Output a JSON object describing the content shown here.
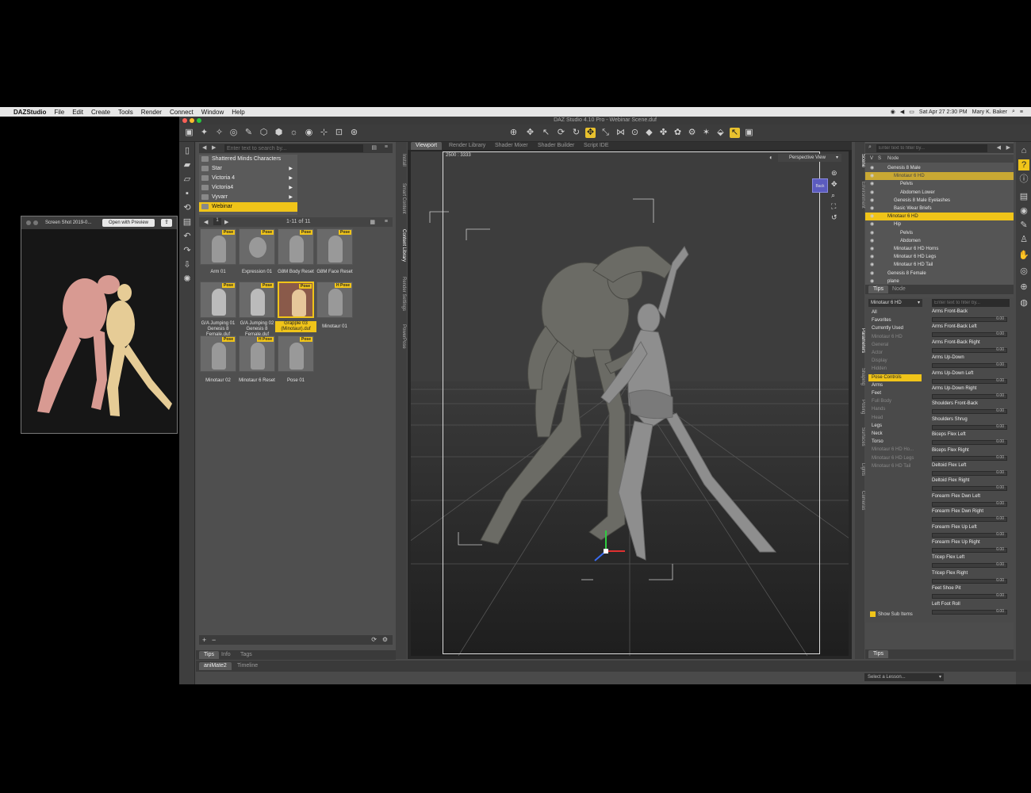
{
  "menubar": {
    "app": "DAZStudio",
    "items": [
      "File",
      "Edit",
      "Create",
      "Tools",
      "Render",
      "Connect",
      "Window",
      "Help"
    ],
    "datetime": "Sat Apr 27  2:30 PM",
    "user": "Mary K. Baker"
  },
  "window": {
    "title": "DAZ Studio 4.10 Pro - Webinar Scene.duf"
  },
  "content_library": {
    "search_placeholder": "Enter text to search by...",
    "folders": [
      {
        "label": "Shattered Minds Characters",
        "has_arrow": false
      },
      {
        "label": "Star",
        "has_arrow": true
      },
      {
        "label": "Victoria 4",
        "has_arrow": true
      },
      {
        "label": "Victoria4",
        "has_arrow": true
      },
      {
        "label": "Vyvarr",
        "has_arrow": true
      },
      {
        "label": "Webinar",
        "has_arrow": false,
        "selected": true
      }
    ],
    "page_info": "1-11 of 11",
    "items": [
      {
        "label": "Arm 01",
        "tag": "Pose"
      },
      {
        "label": "Expression 01",
        "tag": "Pose"
      },
      {
        "label": "G8M Body Reset",
        "tag": "Pose"
      },
      {
        "label": "G8M Face Reset",
        "tag": "Pose"
      },
      {
        "label": "G/A Jumping 01 Genesis 8 Female.duf",
        "tag": "Pose"
      },
      {
        "label": "G/A Jumping 02 Genesis 8 Female.duf",
        "tag": "Pose"
      },
      {
        "label": "Grapple 03 (Minotaur).duf",
        "tag": "Pose",
        "selected": true
      },
      {
        "label": "Minotaur 01",
        "tag": "H Pose"
      },
      {
        "label": "Minotaur 02",
        "tag": "Pose"
      },
      {
        "label": "Minotaur 6 Reset",
        "tag": "H Pose"
      },
      {
        "label": "Pose 01",
        "tag": "Pose"
      }
    ],
    "tabs": [
      "Tips",
      "Info",
      "Tags"
    ]
  },
  "left_vtabs": [
    "Install",
    "Smart Content",
    "Content Library",
    "Render Settings",
    "PowerPose"
  ],
  "viewport": {
    "tabs": [
      "Viewport",
      "Render Library",
      "Shader Mixer",
      "Shader Builder",
      "Script IDE"
    ],
    "dims": "2500 : 3333",
    "view": "Perspective View",
    "cube_label": "Back"
  },
  "scene": {
    "search_placeholder": "Enter text to filter by...",
    "col_v": "V",
    "col_s": "S",
    "col_node": "Node",
    "rows": [
      {
        "label": "Genesis 8 Male",
        "indent": 0,
        "state": ""
      },
      {
        "label": "Minotaur 6 HD",
        "indent": 1,
        "state": "dim"
      },
      {
        "label": "Pelvis",
        "indent": 2,
        "state": ""
      },
      {
        "label": "Abdomen Lower",
        "indent": 2,
        "state": ""
      },
      {
        "label": "Genesis 8 Male Eyelashes",
        "indent": 1,
        "state": ""
      },
      {
        "label": "Basic Wear Briefs",
        "indent": 1,
        "state": ""
      },
      {
        "label": "Minotaur 6 HD",
        "indent": 0,
        "state": "sel"
      },
      {
        "label": "Hip",
        "indent": 1,
        "state": ""
      },
      {
        "label": "Pelvis",
        "indent": 2,
        "state": ""
      },
      {
        "label": "Abdomen",
        "indent": 2,
        "state": ""
      },
      {
        "label": "Minotaur 6 HD Horns",
        "indent": 1,
        "state": ""
      },
      {
        "label": "Minotaur 6 HD Legs",
        "indent": 1,
        "state": ""
      },
      {
        "label": "Minotaur 6 HD Tail",
        "indent": 1,
        "state": ""
      },
      {
        "label": "Genesis 8 Female",
        "indent": 0,
        "state": ""
      },
      {
        "label": "plane",
        "indent": 0,
        "state": ""
      }
    ],
    "tabs": [
      "Tips",
      "Node"
    ]
  },
  "parameters": {
    "selector": "Minotaur 6 HD",
    "search_placeholder": "Enter text to filter by...",
    "categories": [
      {
        "label": "All",
        "state": ""
      },
      {
        "label": "Favorites",
        "state": ""
      },
      {
        "label": "Currently Used",
        "state": ""
      },
      {
        "label": "Minotaur 6 HD",
        "state": "grey"
      },
      {
        "label": "General",
        "state": "grey"
      },
      {
        "label": "Actor",
        "state": "grey"
      },
      {
        "label": "Display",
        "state": "grey"
      },
      {
        "label": "Hidden",
        "state": "grey"
      },
      {
        "label": "Pose Controls",
        "state": "sel"
      },
      {
        "label": "Arms",
        "state": ""
      },
      {
        "label": "Feet",
        "state": ""
      },
      {
        "label": "Full Body",
        "state": "grey"
      },
      {
        "label": "Hands",
        "state": "grey"
      },
      {
        "label": "Head",
        "state": "grey"
      },
      {
        "label": "Legs",
        "state": ""
      },
      {
        "label": "Neck",
        "state": ""
      },
      {
        "label": "Torso",
        "state": ""
      },
      {
        "label": "Minotaur 6 HD Ho...",
        "state": "grey"
      },
      {
        "label": "Minotaur 6 HD Legs",
        "state": "grey"
      },
      {
        "label": "Minotaur 6 HD Tail",
        "state": "grey"
      }
    ],
    "sliders": [
      {
        "label": "Arms Front-Back",
        "value": "0.00"
      },
      {
        "label": "Arms Front-Back Left",
        "value": "0.00"
      },
      {
        "label": "Arms Front-Back Right",
        "value": "0.00"
      },
      {
        "label": "Arms Up-Down",
        "value": "0.00"
      },
      {
        "label": "Arms Up-Down Left",
        "value": "0.00"
      },
      {
        "label": "Arms Up-Down Right",
        "value": "0.00"
      },
      {
        "label": "Shoulders Front-Back",
        "value": "0.00"
      },
      {
        "label": "Shoulders Shrug",
        "value": "0.00"
      },
      {
        "label": "Biceps Flex Left",
        "value": "0.00"
      },
      {
        "label": "Biceps Flex Right",
        "value": "0.00"
      },
      {
        "label": "Deltoid Flex Left",
        "value": "0.00"
      },
      {
        "label": "Deltoid Flex Right",
        "value": "0.00"
      },
      {
        "label": "Forearm Flex Dwn Left",
        "value": "0.00"
      },
      {
        "label": "Forearm Flex Dwn Right",
        "value": "0.00"
      },
      {
        "label": "Forearm Flex Up Left",
        "value": "0.00"
      },
      {
        "label": "Forearm Flex Up Right",
        "value": "0.00"
      },
      {
        "label": "Tricep Flex Left",
        "value": "0.00"
      },
      {
        "label": "Tricep Flex Right",
        "value": "0.00"
      },
      {
        "label": "Feet Shoe Pit",
        "value": "0.00"
      },
      {
        "label": "Left Foot Roll",
        "value": "0.00"
      }
    ],
    "show_sub_items": "Show Sub Items",
    "tips_tab": "Tips"
  },
  "right_vtabs": [
    "Scene",
    "Environment",
    "Parameters",
    "Shaping",
    "Posing",
    "Surfaces",
    "Lights",
    "Cameras"
  ],
  "bottom": {
    "tabs": [
      "aniMate2",
      "Timeline"
    ],
    "lesson": "Select a Lesson..."
  },
  "preview": {
    "title": "Screen Shot 2019-0...",
    "button": "Open with Preview"
  },
  "colors": {
    "accent": "#f0c419",
    "panel": "#4c4c4c",
    "viewport": "#333333"
  }
}
